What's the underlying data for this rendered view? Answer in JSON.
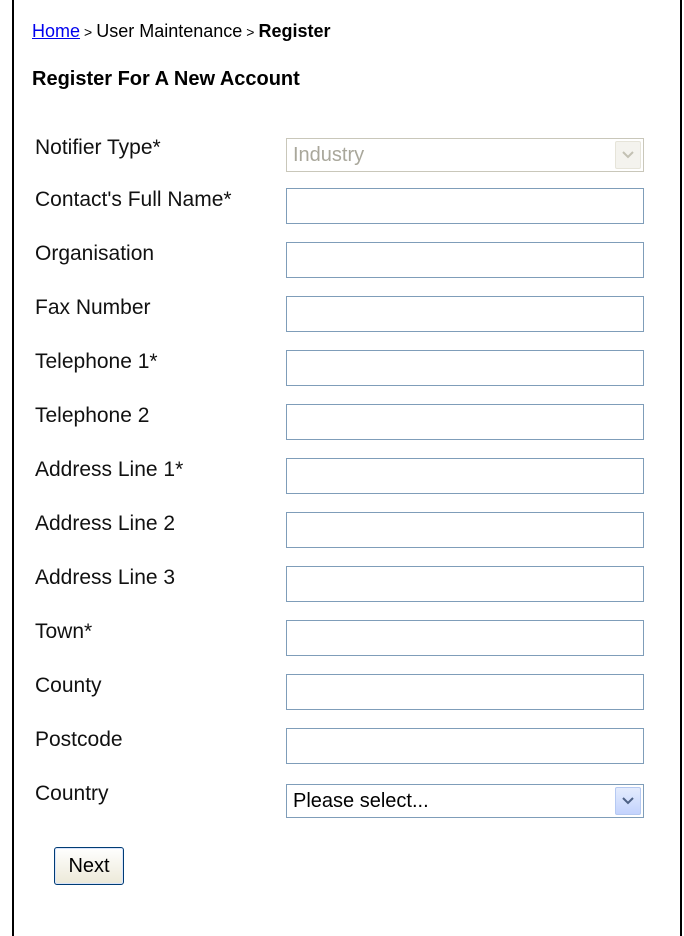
{
  "breadcrumb": {
    "home": "Home",
    "separator_1": ">",
    "section": "User Maintenance",
    "separator_2": ">",
    "current": "Register"
  },
  "page_title": "Register For A New Account",
  "form": {
    "notifier_type": {
      "label": "Notifier Type*",
      "value": "Industry",
      "disabled": true
    },
    "contact_full_name": {
      "label": "Contact's Full Name*",
      "value": ""
    },
    "organisation": {
      "label": "Organisation",
      "value": ""
    },
    "fax_number": {
      "label": "Fax Number",
      "value": ""
    },
    "telephone_1": {
      "label": "Telephone 1*",
      "value": ""
    },
    "telephone_2": {
      "label": "Telephone 2",
      "value": ""
    },
    "address_line_1": {
      "label": "Address Line 1*",
      "value": ""
    },
    "address_line_2": {
      "label": "Address Line 2",
      "value": ""
    },
    "address_line_3": {
      "label": "Address Line 3",
      "value": ""
    },
    "town": {
      "label": "Town*",
      "value": ""
    },
    "county": {
      "label": "County",
      "value": ""
    },
    "postcode": {
      "label": "Postcode",
      "value": ""
    },
    "country": {
      "label": "Country",
      "value": "Please select..."
    }
  },
  "next_label": "Next",
  "colors": {
    "link": "#0000ee",
    "field_border": "#7f9db9",
    "disabled_text": "#a9a79b",
    "button_border": "#003c74"
  }
}
